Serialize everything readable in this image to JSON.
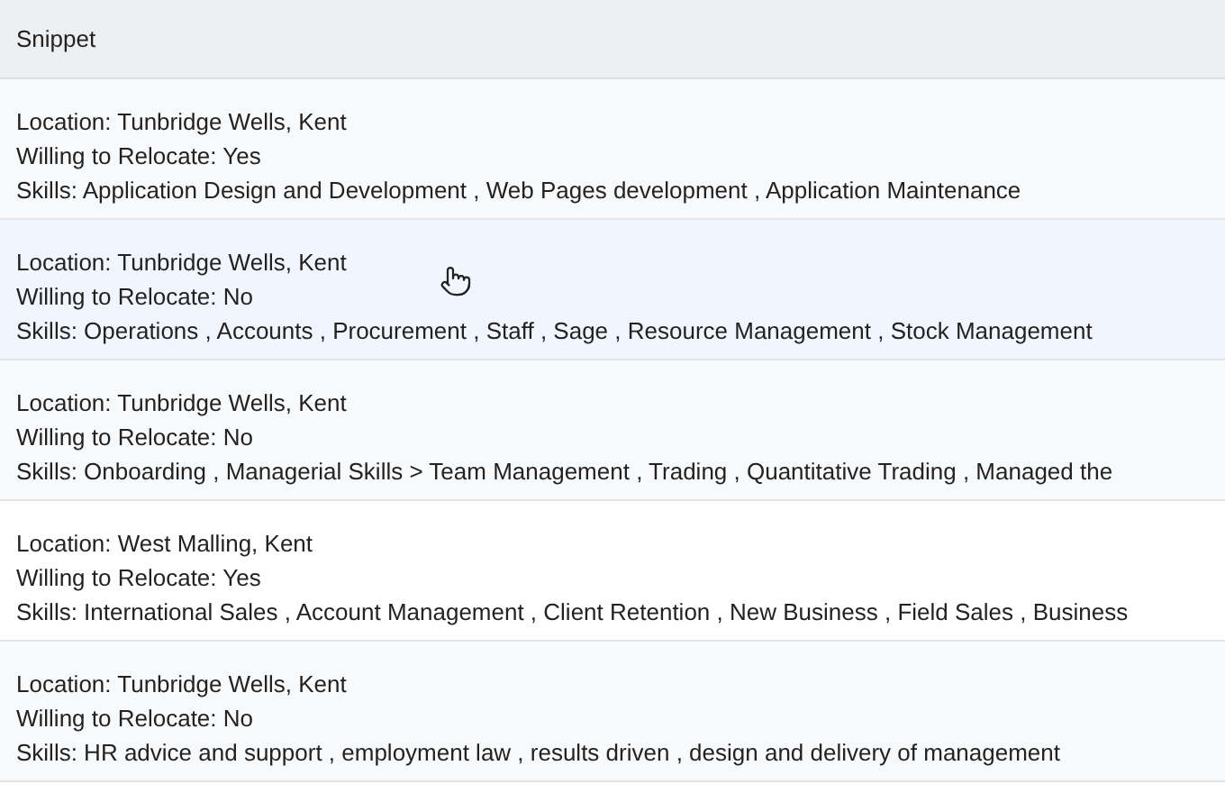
{
  "table": {
    "columns": [
      "Snippet"
    ],
    "rows": [
      {
        "selected": false,
        "location": "Location: Tunbridge Wells, Kent",
        "relocate": "Willing to Relocate: Yes",
        "skills": "Skills: Application Design and Development , Web Pages development , Application Maintenance"
      },
      {
        "selected": true,
        "location": "Location: Tunbridge Wells, Kent",
        "relocate": "Willing to Relocate: No",
        "skills": "Skills: Operations , Accounts , Procurement , Staff , Sage , Resource Management , Stock Management"
      },
      {
        "selected": false,
        "location": "Location: Tunbridge Wells, Kent",
        "relocate": "Willing to Relocate: No",
        "skills": "Skills: Onboarding , Managerial Skills > Team Management , Trading , Quantitative Trading , Managed the"
      },
      {
        "selected": false,
        "location": "Location: West Malling, Kent",
        "relocate": "Willing to Relocate: Yes",
        "skills": "Skills: International Sales , Account Management , Client Retention , New Business , Field Sales , Business"
      },
      {
        "selected": false,
        "location": "Location: Tunbridge Wells, Kent",
        "relocate": "Willing to Relocate: No",
        "skills": "Skills: HR advice and support , employment law , results driven , design and delivery of management"
      }
    ]
  }
}
